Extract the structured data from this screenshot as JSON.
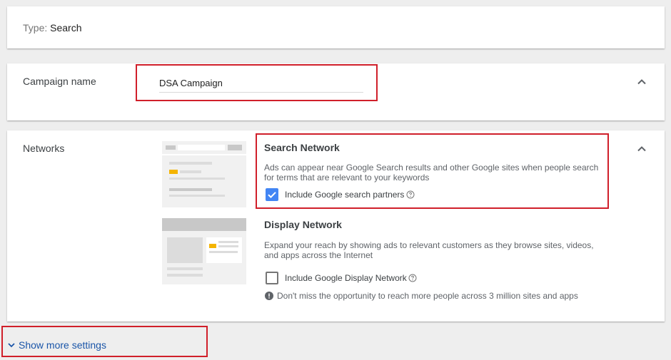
{
  "type_card": {
    "label": "Type:",
    "value": "Search"
  },
  "campaign_name": {
    "label": "Campaign name",
    "value": "DSA Campaign"
  },
  "networks": {
    "label": "Networks",
    "search": {
      "title": "Search Network",
      "description": "Ads can appear near Google Search results and other Google sites when people search for terms that are relevant to your keywords",
      "checkbox_label": "Include Google search partners",
      "checked": true
    },
    "display": {
      "title": "Display Network",
      "description": "Expand your reach by showing ads to relevant customers as they browse sites, videos, and apps across the Internet",
      "checkbox_label": "Include Google Display Network",
      "checked": false,
      "warning": "Don't miss the opportunity to reach more people across 3 million sites and apps"
    }
  },
  "show_more": {
    "label": "Show more settings"
  },
  "colors": {
    "accent": "#4285f4",
    "link": "#1a55a8",
    "highlight": "#d01f2a",
    "ad_marker": "#f4b400"
  }
}
